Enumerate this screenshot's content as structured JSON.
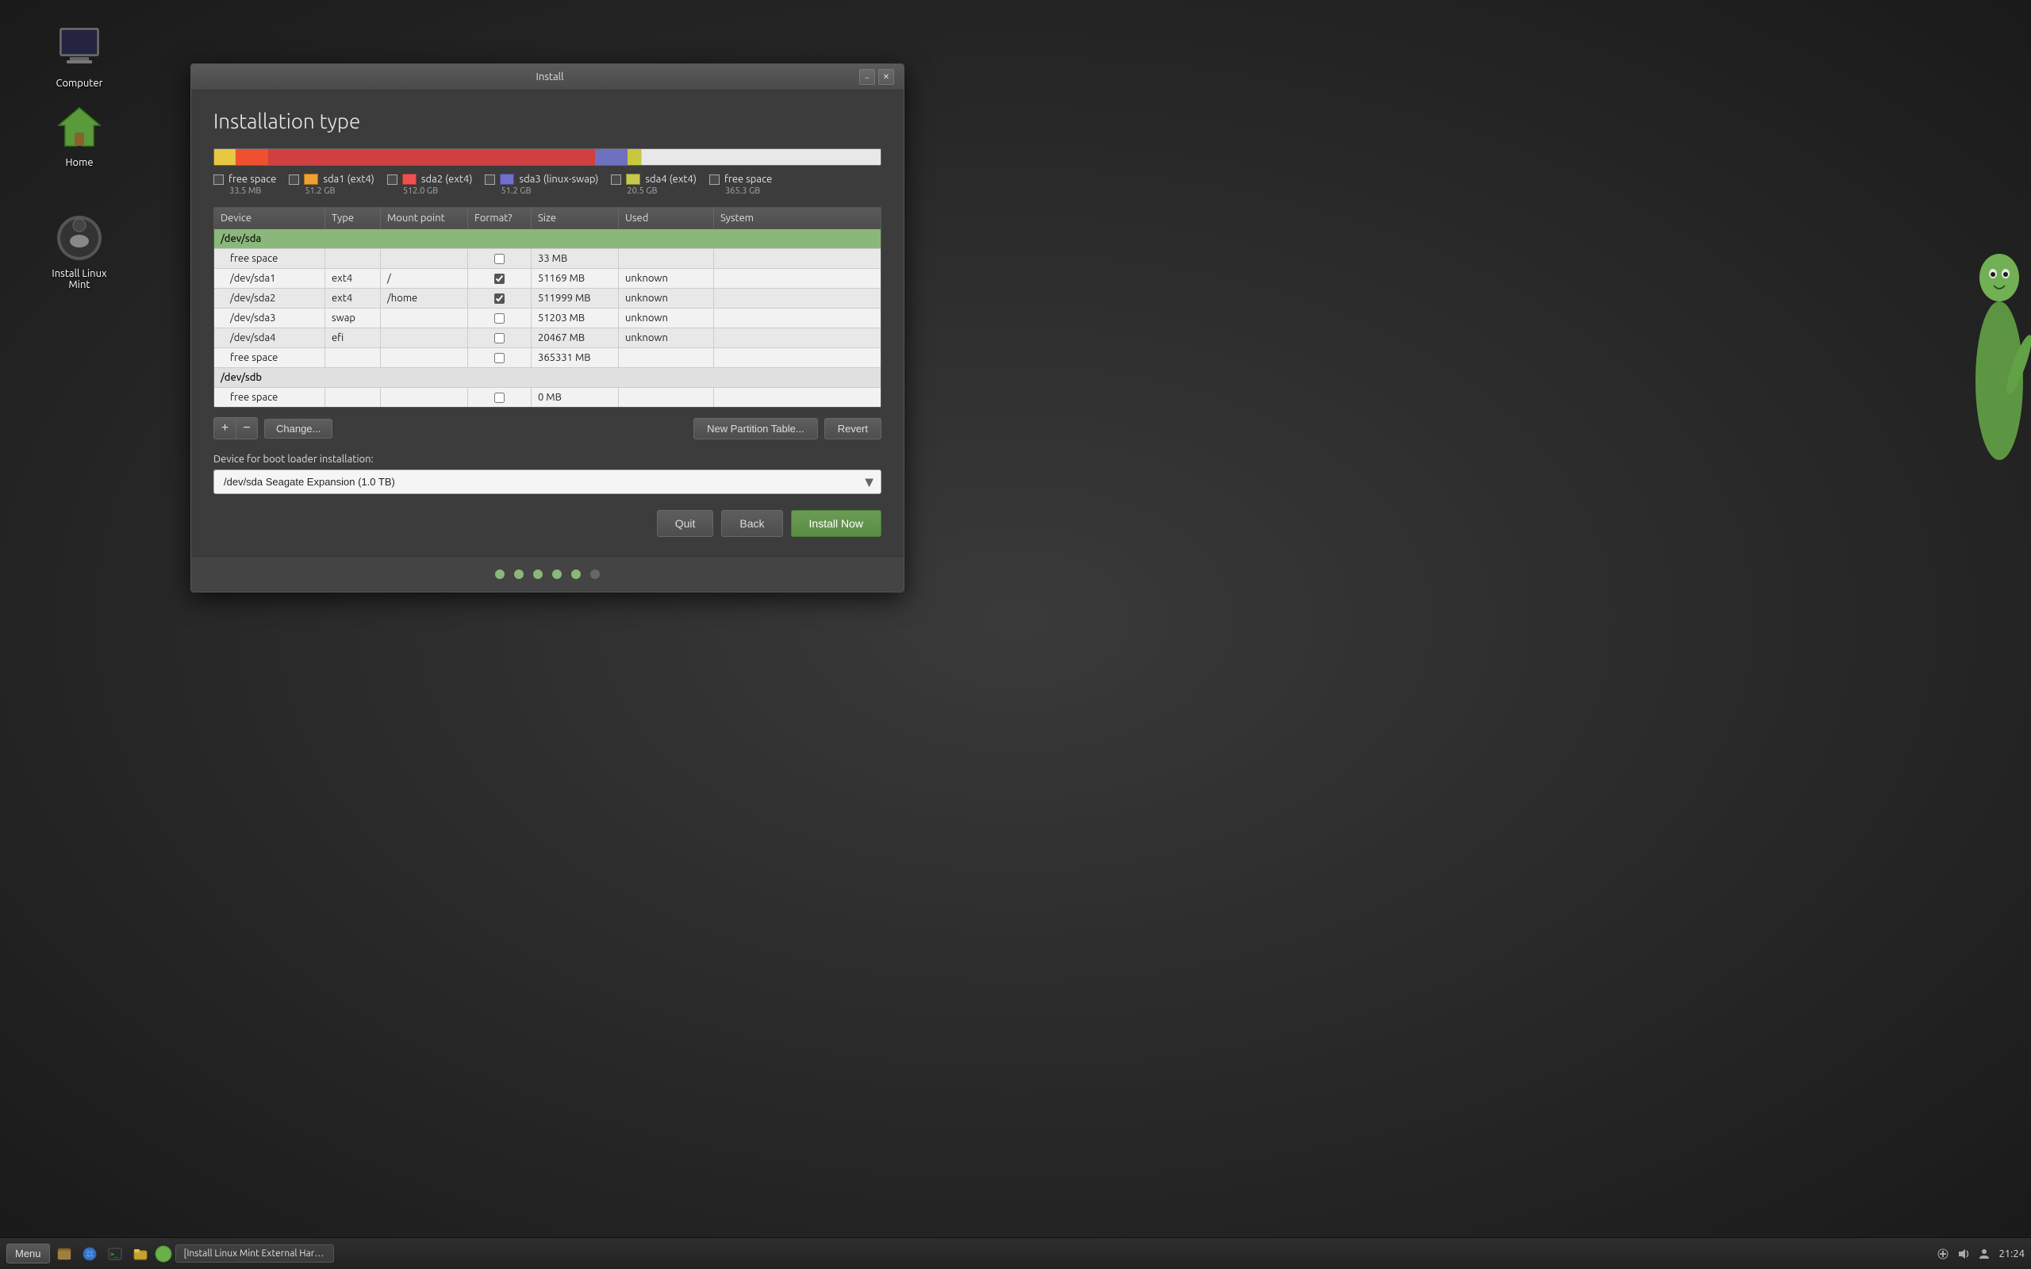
{
  "window": {
    "title": "Install",
    "page_title": "Installation type"
  },
  "partition_bar": {
    "segments": [
      {
        "color": "#e8c840",
        "width": "3.2%",
        "title": "free space 33.5 MB"
      },
      {
        "color": "#f05050",
        "width": "4.8%",
        "title": "sda1 (ext4) 51.2 GB"
      },
      {
        "color": "#ff6666",
        "width": "4.9%",
        "title": "sda2 (ext4) 512.0 GB"
      },
      {
        "color": "#7777cc",
        "width": "4.8%",
        "title": "sda3 (linux-swap) 51.2 GB"
      },
      {
        "color": "#c8c850",
        "width": "1.9%",
        "title": "sda4 (ext4) 20.5 GB"
      },
      {
        "color": "#f0f0f0",
        "width": "34%",
        "title": "free space 365.3 GB"
      }
    ]
  },
  "legend": [
    {
      "label": "free space",
      "size": "33.5 MB",
      "color": "transparent",
      "has_checkbox": true,
      "checkbox_checked": false
    },
    {
      "label": "sda1 (ext4)",
      "size": "51.2 GB",
      "color": "#f0a030",
      "has_checkbox": true,
      "checkbox_checked": false
    },
    {
      "label": "sda2 (ext4)",
      "size": "512.0 GB",
      "color": "#f05050",
      "has_checkbox": true,
      "checkbox_checked": false
    },
    {
      "label": "sda3 (linux-swap)",
      "size": "51.2 GB",
      "color": "#7777cc",
      "has_checkbox": true,
      "checkbox_checked": false
    },
    {
      "label": "sda4 (ext4)",
      "size": "20.5 GB",
      "color": "#c8c850",
      "has_checkbox": true,
      "checkbox_checked": false
    },
    {
      "label": "free space",
      "size": "365.3 GB",
      "color": "transparent",
      "has_checkbox": true,
      "checkbox_checked": false
    }
  ],
  "table": {
    "headers": [
      "Device",
      "Type",
      "Mount point",
      "Format?",
      "Size",
      "Used",
      "System"
    ],
    "rows": [
      {
        "type": "group",
        "device": "/dev/sda",
        "selected": true
      },
      {
        "type": "data",
        "device": "free space",
        "fs": "",
        "mount": "",
        "format": false,
        "size": "33 MB",
        "used": "",
        "system": ""
      },
      {
        "type": "data",
        "device": "/dev/sda1",
        "fs": "ext4",
        "mount": "/",
        "format": true,
        "size": "51169 MB",
        "used": "unknown",
        "system": ""
      },
      {
        "type": "data",
        "device": "/dev/sda2",
        "fs": "ext4",
        "mount": "/home",
        "format": true,
        "size": "511999 MB",
        "used": "unknown",
        "system": ""
      },
      {
        "type": "data",
        "device": "/dev/sda3",
        "fs": "swap",
        "mount": "",
        "format": false,
        "size": "51203 MB",
        "used": "unknown",
        "system": ""
      },
      {
        "type": "data",
        "device": "/dev/sda4",
        "fs": "efi",
        "mount": "",
        "format": false,
        "size": "20467 MB",
        "used": "unknown",
        "system": ""
      },
      {
        "type": "data",
        "device": "free space",
        "fs": "",
        "mount": "",
        "format": false,
        "size": "365331 MB",
        "used": "",
        "system": ""
      },
      {
        "type": "group",
        "device": "/dev/sdb",
        "selected": false
      },
      {
        "type": "data",
        "device": "free space",
        "fs": "",
        "mount": "",
        "format": false,
        "size": "0 MB",
        "used": "",
        "system": ""
      }
    ]
  },
  "toolbar": {
    "add_label": "+",
    "remove_label": "−",
    "change_label": "Change...",
    "new_partition_table_label": "New Partition Table...",
    "revert_label": "Revert"
  },
  "bootloader": {
    "label": "Device for boot loader installation:",
    "value": "/dev/sda   Seagate Expansion (1.0 TB)"
  },
  "buttons": {
    "quit": "Quit",
    "back": "Back",
    "install_now": "Install Now"
  },
  "progress_dots": [
    {
      "active": true
    },
    {
      "active": true
    },
    {
      "active": true
    },
    {
      "active": true
    },
    {
      "active": true
    },
    {
      "active": false
    }
  ],
  "taskbar": {
    "menu_label": "Menu",
    "task_label": "[Install Linux Mint External Hard Drive Parti...",
    "install_task": "Install",
    "clock": "21:24",
    "date": ""
  },
  "desktop_icons": [
    {
      "id": "computer",
      "label": "Computer"
    },
    {
      "id": "home",
      "label": "Home"
    },
    {
      "id": "mint",
      "label": "Install Linux Mint"
    }
  ]
}
